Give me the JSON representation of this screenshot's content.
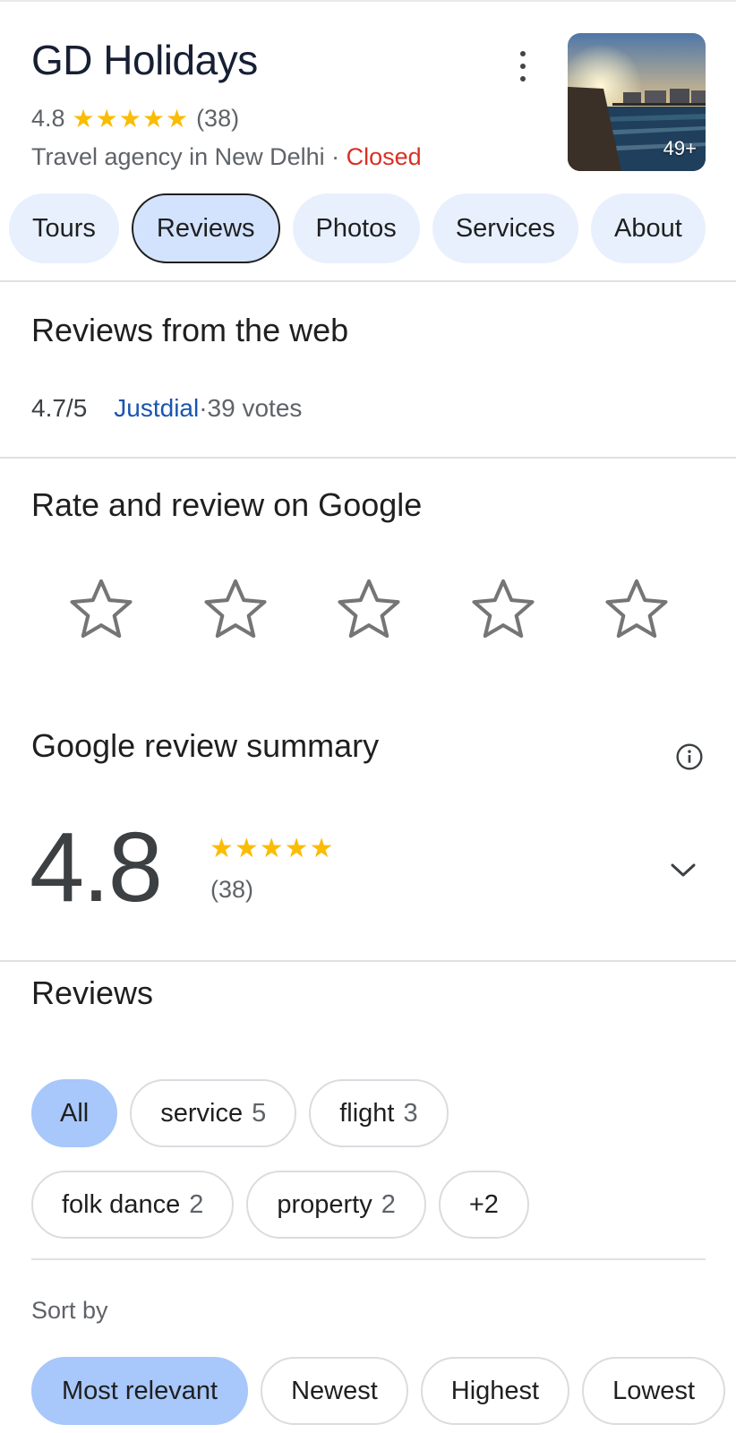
{
  "business": {
    "name": "GD Holidays",
    "rating": "4.8",
    "stars": "★★★★★",
    "review_count": "(38)",
    "category_location": "Travel agency in New Delhi",
    "separator": " · ",
    "status": "Closed",
    "photo_count": "49+"
  },
  "tabs": [
    {
      "label": "Tours"
    },
    {
      "label": "Reviews"
    },
    {
      "label": "Photos"
    },
    {
      "label": "Services"
    },
    {
      "label": "About"
    }
  ],
  "web_reviews": {
    "heading": "Reviews from the web",
    "score": "4.7/5",
    "source": "Justdial",
    "separator": " · ",
    "votes": "39 votes"
  },
  "rate": {
    "heading": "Rate and review on Google"
  },
  "summary": {
    "heading": "Google review summary",
    "score": "4.8",
    "stars": "★★★★★",
    "count": "(38)"
  },
  "reviews": {
    "heading": "Reviews",
    "topics": [
      {
        "label": "All",
        "count": ""
      },
      {
        "label": "service",
        "count": "5"
      },
      {
        "label": "flight",
        "count": "3"
      },
      {
        "label": "folk dance",
        "count": "2"
      },
      {
        "label": "property",
        "count": "2"
      },
      {
        "label": "+2",
        "count": ""
      }
    ]
  },
  "sort": {
    "label": "Sort by",
    "options": [
      {
        "label": "Most relevant"
      },
      {
        "label": "Newest"
      },
      {
        "label": "Highest"
      },
      {
        "label": "Lowest"
      }
    ]
  },
  "colors": {
    "star_gold": "#fbbc04",
    "closed_red": "#d93025",
    "link_blue": "#1a55b0",
    "chip_active": "#a8c7fa",
    "tab_bg": "#e8f0fe"
  }
}
